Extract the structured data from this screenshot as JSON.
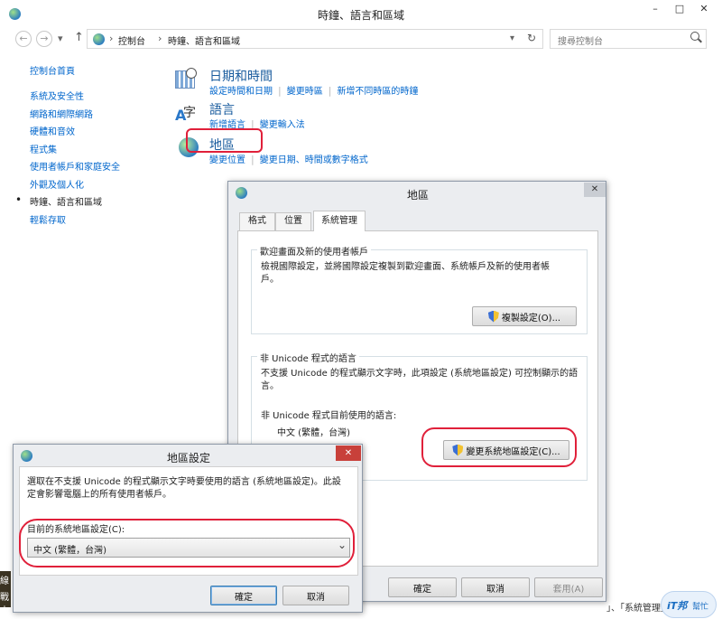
{
  "window": {
    "title": "時鐘、語言和區域",
    "min": "–",
    "max": "□",
    "close": "✕"
  },
  "address": {
    "back": "←",
    "forward": "→",
    "dropdown": "▾",
    "up": "↑",
    "root_arrow": "›",
    "crumbs": [
      "控制台",
      "時鐘、語言和區域"
    ],
    "refresh": "↻",
    "search_placeholder": "搜尋控制台",
    "search_icon": "🔍"
  },
  "sidebar": {
    "home": "控制台首頁",
    "items": [
      {
        "label": "系統及安全性"
      },
      {
        "label": "網路和網際網路"
      },
      {
        "label": "硬體和音效"
      },
      {
        "label": "程式集"
      },
      {
        "label": "使用者帳戶和家庭安全"
      },
      {
        "label": "外觀及個人化"
      },
      {
        "label": "時鐘、語言和區域",
        "current": true
      },
      {
        "label": "輕鬆存取"
      }
    ],
    "bullet": "•"
  },
  "categories": [
    {
      "title": "日期和時間",
      "icon": "calendar-clock-icon",
      "links": [
        "設定時間和日期",
        "變更時區",
        "新增不同時區的時鐘"
      ]
    },
    {
      "title": "語言",
      "icon": "language-icon",
      "links": [
        "新增語言",
        "變更輸入法"
      ]
    },
    {
      "title": "地區",
      "icon": "region-globe-icon",
      "links": [
        "變更位置",
        "變更日期、時間或數字格式"
      ]
    }
  ],
  "region_dialog": {
    "title": "地區",
    "close": "✕",
    "tabs": [
      "格式",
      "位置",
      "系統管理"
    ],
    "welcome_group": {
      "title": "歡迎畫面及新的使用者帳戶",
      "text": "檢視國際設定，並將國際設定複製到歡迎畫面、系統帳戶及新的使用者帳戶。",
      "button": "複製設定(O)..."
    },
    "unicode_group": {
      "title": "非 Unicode 程式的語言",
      "text": "不支援 Unicode 的程式顯示文字時，此項設定 (系統地區設定) 可控制顯示的語言。",
      "current_label": "非 Unicode 程式目前使用的語言:",
      "current_value": "中文 (繁體，台灣)",
      "button": "變更系統地區設定(C)..."
    },
    "ok": "確定",
    "cancel": "取消",
    "apply": "套用(A)"
  },
  "locale_dialog": {
    "title": "地區設定",
    "close": "✕",
    "description": "選取在不支援 Unicode 的程式顯示文字時要使用的語言 (系統地區設定)。此設定會影響電腦上的所有使用者帳戶。",
    "current_label": "目前的系統地區設定(C):",
    "current_value": "中文 (繁體，台灣)",
    "dropdown_arrow": "⌄",
    "ok": "確定",
    "cancel": "取消"
  },
  "background": {
    "left_edge_text": [
      "線",
      "戰士"
    ],
    "bottom_text": "」、「系統管理」，點",
    "logo": [
      "iT邦",
      "幫忙"
    ]
  },
  "colors": {
    "link": "#0066cc",
    "category_title": "#1a5c9e",
    "highlight": "#e0203a",
    "close_red": "#c8403a"
  }
}
